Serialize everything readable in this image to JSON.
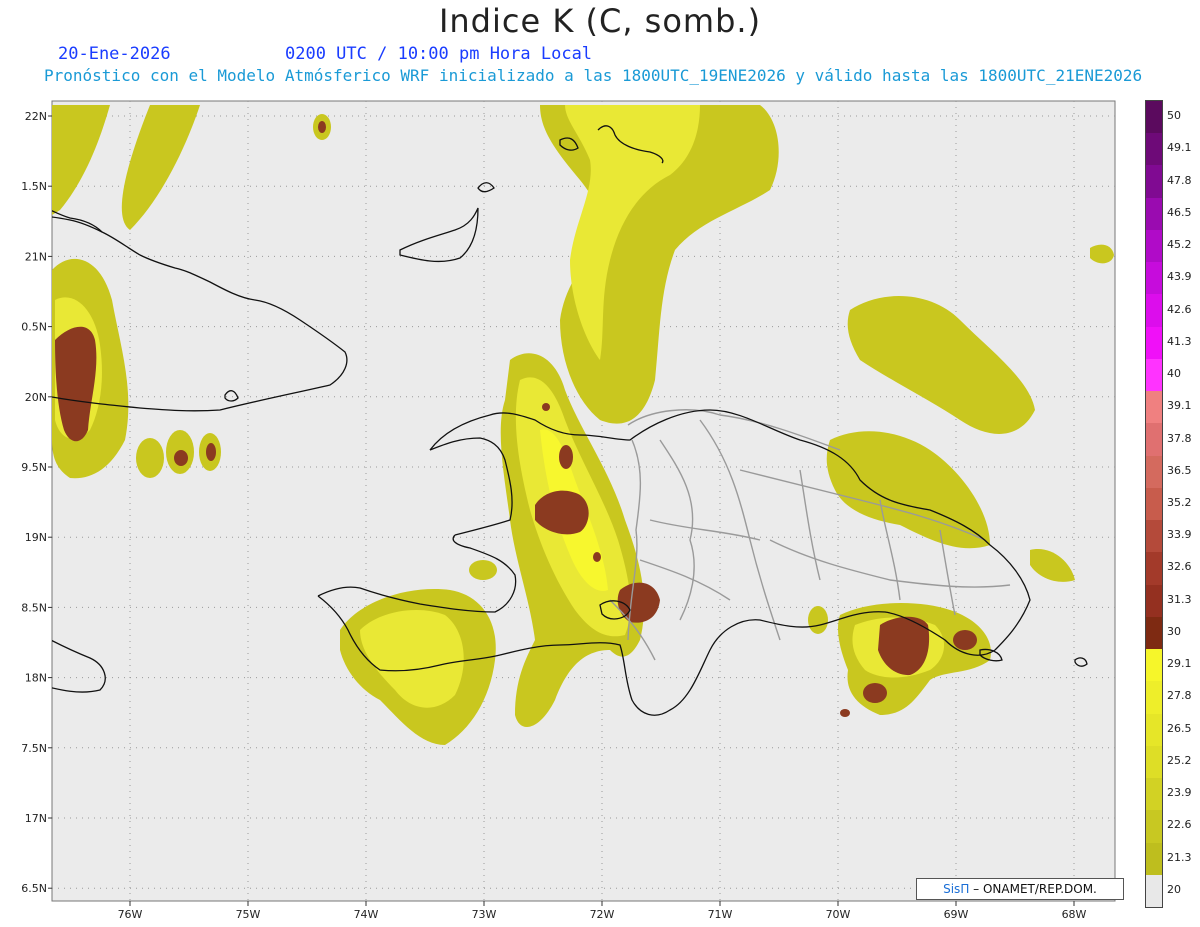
{
  "title": "Indice K (C, somb.)",
  "date": "20-Ene-2026",
  "time_info": "0200 UTC / 10:00 pm Hora Local",
  "model_info": "Pronóstico con el Modelo Atmósferico WRF inicializado a las 1800UTC_19ENE2026 y válido hasta las  1800UTC_21ENE2026",
  "credit": {
    "sis": "SisΠ",
    "org": " – ONAMET/REP.DOM."
  },
  "lat_labels": [
    "22N",
    "1.5N",
    "21N",
    "0.5N",
    "20N",
    "9.5N",
    "19N",
    "8.5N",
    "18N",
    "7.5N",
    "17N",
    "6.5N"
  ],
  "lon_labels": [
    "76W",
    "75W",
    "74W",
    "73W",
    "72W",
    "71W",
    "70W",
    "69W",
    "68W"
  ],
  "legend": {
    "labels": [
      "50",
      "49.1",
      "47.8",
      "46.5",
      "45.2",
      "43.9",
      "42.6",
      "41.3",
      "40",
      "39.1",
      "37.8",
      "36.5",
      "35.2",
      "33.9",
      "32.6",
      "31.3",
      "30",
      "29.1",
      "27.8",
      "26.5",
      "25.2",
      "23.9",
      "22.6",
      "21.3",
      "20"
    ],
    "colors": [
      "#5b0a5e",
      "#6e0a78",
      "#800a92",
      "#9a0bb0",
      "#b00bc8",
      "#c60cdc",
      "#dc0dec",
      "#f010f8",
      "#ff33ff",
      "#f08080",
      "#e07070",
      "#d46a5e",
      "#c85c4c",
      "#b44a3a",
      "#a33a2a",
      "#943020",
      "#7e2a12",
      "#f6f62a",
      "#eeee2a",
      "#e6e628",
      "#dede26",
      "#d2d224",
      "#c8c822",
      "#bebe1e",
      "#e8e8e8"
    ]
  },
  "palette": {
    "background": "#ebebeb",
    "low": "#c9c71f",
    "mid": "#e9e835",
    "high": "#f7f72e",
    "core": "#8b3a20",
    "coast": "#111111",
    "border": "#999999"
  }
}
